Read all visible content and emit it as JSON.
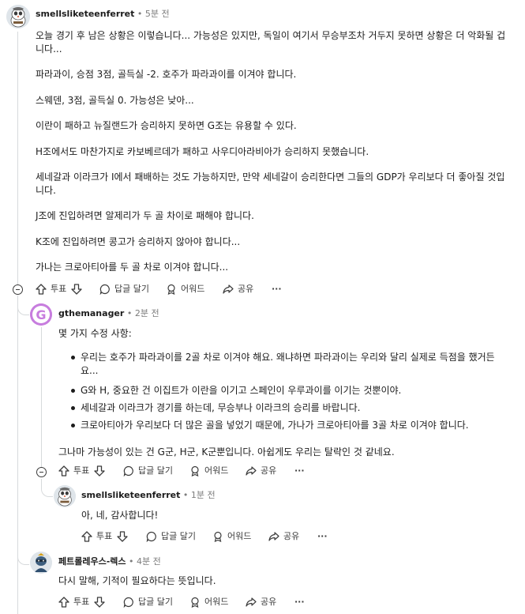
{
  "colors": {
    "text": "#1c1c1c",
    "meta": "#7c7c7c",
    "thread": "#d7dadc",
    "gthemanager_avatar": "#c77dde"
  },
  "comment1": {
    "username": "smellsliketeenferret",
    "sep": "•",
    "time": "5분 전",
    "avatar_icon": "ferret-snoo-avatar",
    "lines": [
      "오늘 경기 후 남은 상황은 이렇습니다... 가능성은 있지만, 독일이 여기서 무승부조차 거두지 못하면 상황은 더 악화될 겁",
      "니다...",
      "파라과이, 승점 3점, 골득실 -2. 호주가 파라과이를 이겨야 합니다.",
      "스웨덴, 3점, 골득실 0. 가능성은 낮아...",
      "이란이 패하고 뉴질랜드가 승리하지 못하면 G조는 유용할 수 있다.",
      "H조에서도 마찬가지로 카보베르데가 패하고 사우디아라비아가 승리하지 못했습니다.",
      "세네갈과 이라크가 I에서 패배하는 것도 가능하지만, 만약 세네갈이 승리한다면 그들의 GDP가 우리보다 더 좋아질 것입",
      "니다.",
      "J조에 진입하려면 알제리가 두 골 차이로 패해야 합니다.",
      "K조에 진입하려면 콩고가 승리하지 않아야 합니다...",
      "가나는 크로아티아를 두 골 차로 이겨야 합니다..."
    ]
  },
  "comment2": {
    "username": "gthemanager",
    "sep": "•",
    "time": "2분 전",
    "avatar_letter": "G",
    "intro": "몇 가지 수정 사항:",
    "items": [
      "우리는 호주가 파라과이를 2골 차로 이겨야 해요. 왜냐하면 파라과이는 우리와 달리 실제로 득점을 했거든",
      "요...",
      "G와 H, 중요한 건 이집트가 이란을 이기고 스페인이 우루과이를 이기는 것뿐이야.",
      "세네갈과 이라크가 경기를 하는데, 무승부나 이라크의 승리를 바랍니다.",
      "크로아티아가 우리보다 더 많은 골을 넣었기 때문에, 가나가 크로아티아를 3골 차로 이겨야 합니다."
    ],
    "closing": "그나마 가능성이 있는 건 G군, H군, K군뿐입니다. 아쉽게도 우리는 탈락인 것 같네요."
  },
  "comment3": {
    "username": "smellsliketeenferret",
    "sep": "•",
    "time": "1분 전",
    "avatar_icon": "ferret-snoo-avatar",
    "text": "아, 네, 감사합니다!"
  },
  "comment4": {
    "username": "페트롤레우스-렉스",
    "sep": "•",
    "time": "4분 전",
    "avatar_icon": "knight-snoo-avatar",
    "text": "다시 말해, 기적이 필요하다는 뜻입니다."
  },
  "actions": {
    "vote_label": "투표",
    "reply_label": "답글 달기",
    "award_label": "어워드",
    "share_label": "공유",
    "more_label": "···"
  }
}
